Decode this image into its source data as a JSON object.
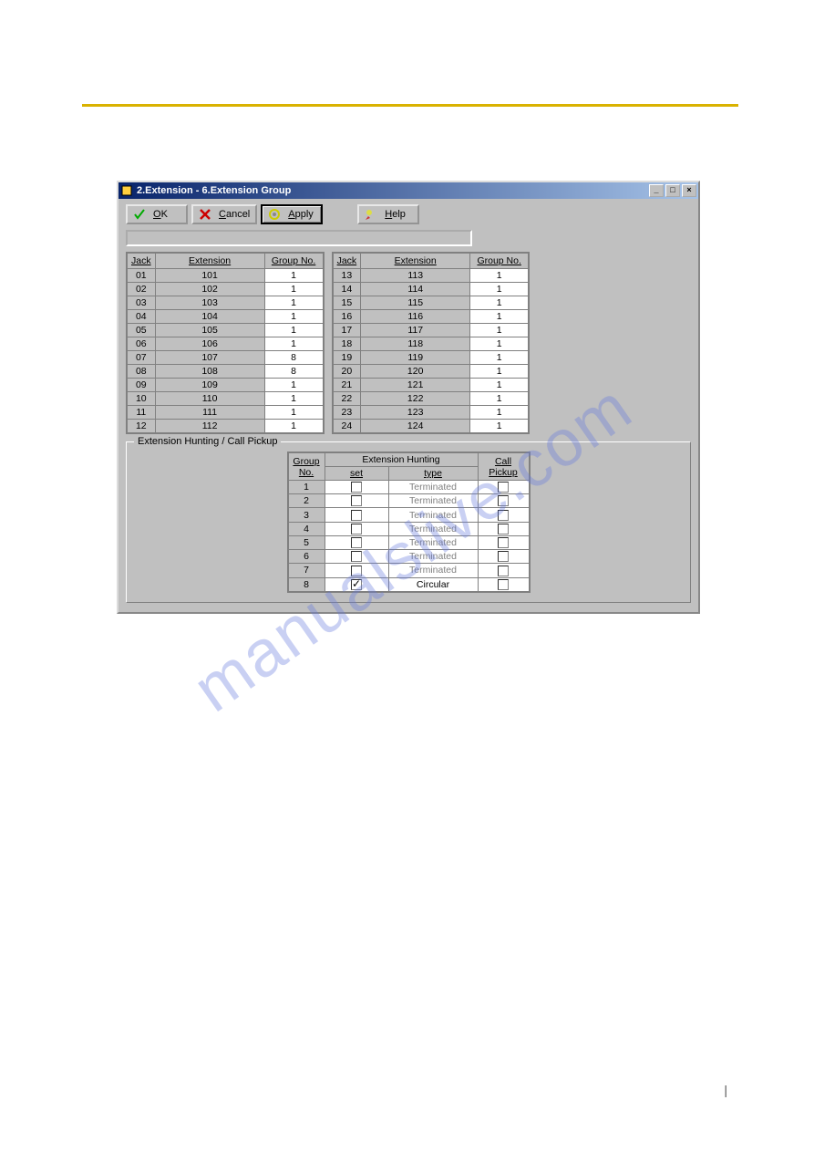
{
  "window": {
    "title": "2.Extension - 6.Extension Group"
  },
  "toolbar": {
    "ok_label": "OK",
    "cancel_label": "Cancel",
    "apply_label": "Apply",
    "help_label": "Help"
  },
  "grid_headers": {
    "jack": "Jack",
    "extension": "Extension",
    "group_no": "Group No."
  },
  "rows_left": [
    {
      "jack": "01",
      "ext": "101",
      "grp": "1"
    },
    {
      "jack": "02",
      "ext": "102",
      "grp": "1"
    },
    {
      "jack": "03",
      "ext": "103",
      "grp": "1"
    },
    {
      "jack": "04",
      "ext": "104",
      "grp": "1"
    },
    {
      "jack": "05",
      "ext": "105",
      "grp": "1"
    },
    {
      "jack": "06",
      "ext": "106",
      "grp": "1"
    },
    {
      "jack": "07",
      "ext": "107",
      "grp": "8"
    },
    {
      "jack": "08",
      "ext": "108",
      "grp": "8"
    },
    {
      "jack": "09",
      "ext": "109",
      "grp": "1"
    },
    {
      "jack": "10",
      "ext": "110",
      "grp": "1"
    },
    {
      "jack": "11",
      "ext": "111",
      "grp": "1"
    },
    {
      "jack": "12",
      "ext": "112",
      "grp": "1"
    }
  ],
  "rows_right": [
    {
      "jack": "13",
      "ext": "113",
      "grp": "1"
    },
    {
      "jack": "14",
      "ext": "114",
      "grp": "1"
    },
    {
      "jack": "15",
      "ext": "115",
      "grp": "1"
    },
    {
      "jack": "16",
      "ext": "116",
      "grp": "1"
    },
    {
      "jack": "17",
      "ext": "117",
      "grp": "1"
    },
    {
      "jack": "18",
      "ext": "118",
      "grp": "1"
    },
    {
      "jack": "19",
      "ext": "119",
      "grp": "1"
    },
    {
      "jack": "20",
      "ext": "120",
      "grp": "1"
    },
    {
      "jack": "21",
      "ext": "121",
      "grp": "1"
    },
    {
      "jack": "22",
      "ext": "122",
      "grp": "1"
    },
    {
      "jack": "23",
      "ext": "123",
      "grp": "1"
    },
    {
      "jack": "24",
      "ext": "124",
      "grp": "1"
    }
  ],
  "hunt": {
    "fieldset_label": "Extension Hunting / Call Pickup",
    "headers": {
      "group_no_1": "Group",
      "group_no_2": "No.",
      "ext_hunting": "Extension Hunting",
      "set": "set",
      "type": "type",
      "call_pickup": "Call Pickup"
    },
    "rows": [
      {
        "no": "1",
        "set": false,
        "type": "Terminated",
        "type_enabled": false,
        "cp": false
      },
      {
        "no": "2",
        "set": false,
        "type": "Terminated",
        "type_enabled": false,
        "cp": false
      },
      {
        "no": "3",
        "set": false,
        "type": "Terminated",
        "type_enabled": false,
        "cp": false
      },
      {
        "no": "4",
        "set": false,
        "type": "Terminated",
        "type_enabled": false,
        "cp": false
      },
      {
        "no": "5",
        "set": false,
        "type": "Terminated",
        "type_enabled": false,
        "cp": false
      },
      {
        "no": "6",
        "set": false,
        "type": "Terminated",
        "type_enabled": false,
        "cp": false
      },
      {
        "no": "7",
        "set": false,
        "type": "Terminated",
        "type_enabled": false,
        "cp": false
      },
      {
        "no": "8",
        "set": true,
        "type": "Circular",
        "type_enabled": true,
        "cp": false
      }
    ]
  },
  "watermark": "manualslive.com"
}
